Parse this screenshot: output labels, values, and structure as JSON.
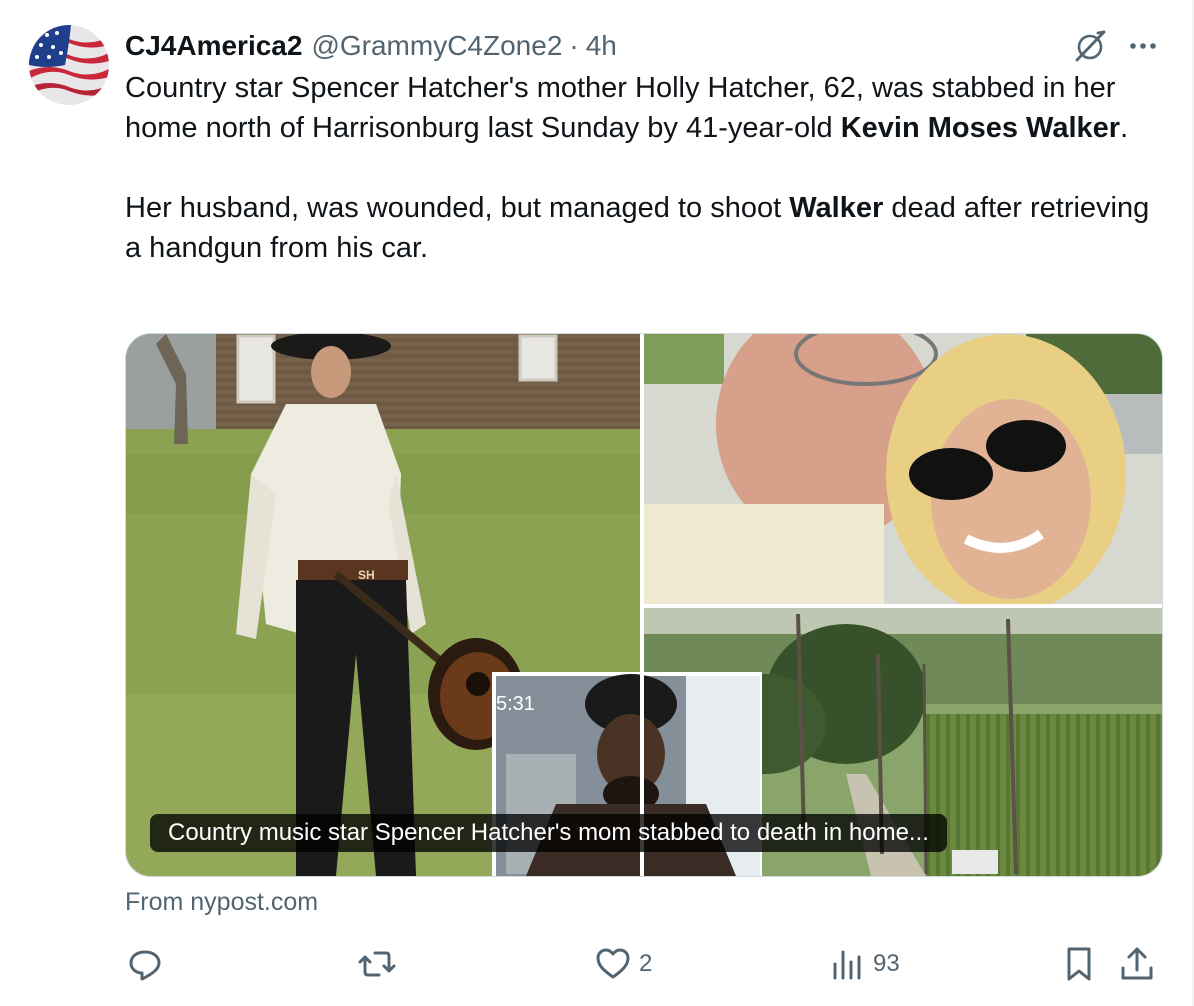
{
  "tweet": {
    "display_name": "CJ4America2",
    "handle": "@GrammyC4Zone2",
    "separator": "·",
    "time": "4h",
    "paragraph1": {
      "before": "Country star Spencer Hatcher's mother Holly Hatcher, 62, was stabbed in her home north of Harrisonburg last Sunday by 41-year-old ",
      "bold": "Kevin Moses Walker",
      "after": "."
    },
    "paragraph2": {
      "before": "Her husband, was wounded, but managed to shoot ",
      "bold": "Walker",
      "after": " dead after retrieving a handgun from his car."
    }
  },
  "card": {
    "caption": "Country music star Spencer Hatcher's mom stabbed to death in home...",
    "timestamp_overlay": "5:31",
    "belt_text": "SH",
    "source": "From nypost.com"
  },
  "actions": {
    "replies": "",
    "reposts": "",
    "likes": "2",
    "views": "93"
  },
  "icons": {
    "avatar": "american-flag-avatar",
    "grok": "grok-icon",
    "more": "more-icon",
    "reply": "reply-icon",
    "repost": "repost-icon",
    "like": "heart-icon",
    "views": "views-icon",
    "bookmark": "bookmark-icon",
    "share": "share-icon"
  },
  "colors": {
    "text": "#0f1419",
    "secondary": "#536471",
    "border": "#cfd9de"
  }
}
